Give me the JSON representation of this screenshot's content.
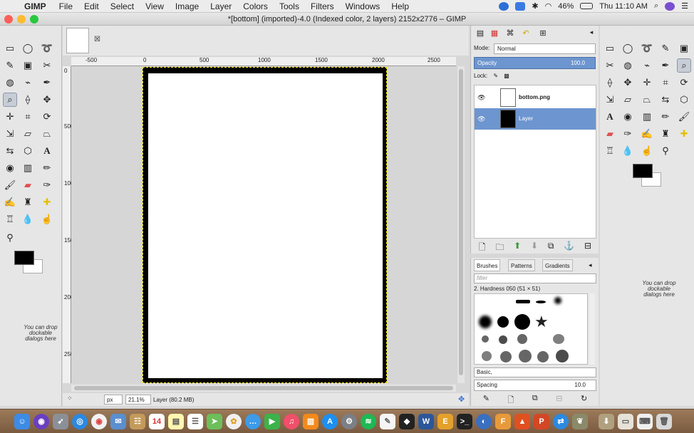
{
  "menubar": {
    "app_name": "GIMP",
    "items": [
      "File",
      "Edit",
      "Select",
      "View",
      "Image",
      "Layer",
      "Colors",
      "Tools",
      "Filters",
      "Windows",
      "Help"
    ],
    "battery": "46%",
    "clock": "Thu 11:10 AM"
  },
  "window": {
    "title": "*[bottom] (imported)-4.0 (Indexed color, 2 layers) 2152x2776 – GIMP"
  },
  "ruler": {
    "top_ticks": [
      "-500",
      "0",
      "500",
      "1000",
      "1500",
      "2000",
      "2500"
    ],
    "left_ticks": [
      "0",
      "500",
      "1000",
      "1500",
      "2000",
      "2500"
    ]
  },
  "statusbar": {
    "unit": "px",
    "zoom": "21.1%",
    "info": "Layer (80.2 MB)"
  },
  "layers": {
    "mode_label": "Mode:",
    "mode_value": "Normal",
    "opacity_label": "Opacity",
    "opacity_value": "100.0",
    "lock_label": "Lock:",
    "items": [
      {
        "name": "bottom.png",
        "selected": false
      },
      {
        "name": "Layer",
        "selected": true
      }
    ]
  },
  "brushes": {
    "tabs": [
      "Brushes",
      "Patterns",
      "Gradients"
    ],
    "filter_placeholder": "filter",
    "selected_brush": "2. Hardness 050 (51 × 51)",
    "preset": "Basic,",
    "spacing_label": "Spacing",
    "spacing_value": "10.0"
  },
  "drop_hint": "You can drop dockable dialogs here",
  "colors": {
    "foreground": "#000000",
    "background": "#ffffff",
    "selection": "#6d95cf"
  }
}
